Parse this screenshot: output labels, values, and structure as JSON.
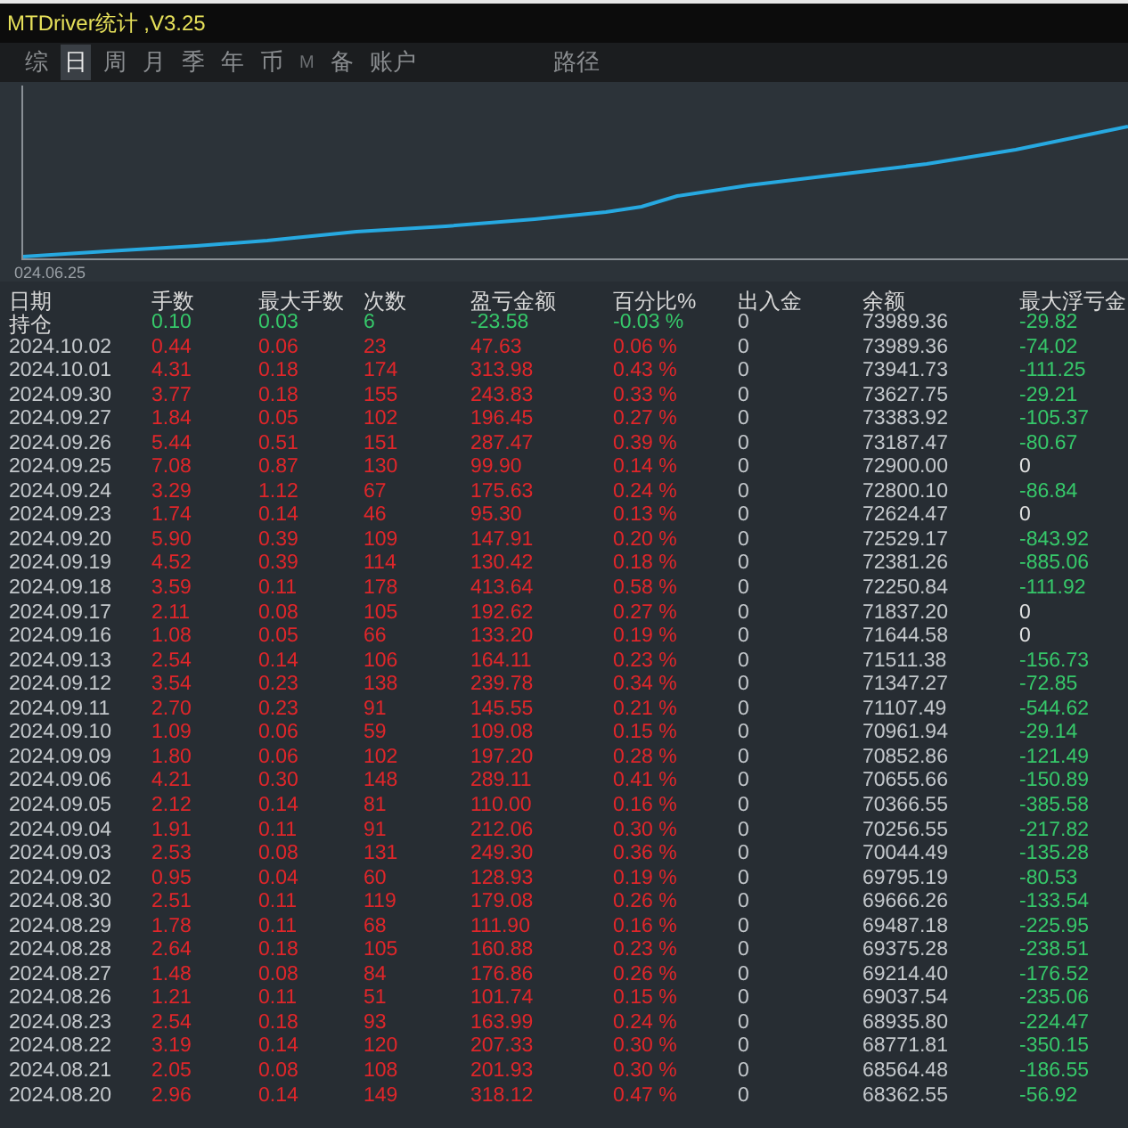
{
  "window": {
    "title": "MTDriver统计 ,V3.25"
  },
  "tabs": [
    {
      "label": "综",
      "selected": false,
      "kind": "tab"
    },
    {
      "label": "日",
      "selected": true,
      "kind": "tab"
    },
    {
      "label": "周",
      "selected": false,
      "kind": "tab"
    },
    {
      "label": "月",
      "selected": false,
      "kind": "tab"
    },
    {
      "label": "季",
      "selected": false,
      "kind": "tab"
    },
    {
      "label": "年",
      "selected": false,
      "kind": "tab"
    },
    {
      "label": "币",
      "selected": false,
      "kind": "tab"
    },
    {
      "label": "M",
      "selected": false,
      "kind": "small"
    },
    {
      "label": "备",
      "selected": false,
      "kind": "tab"
    },
    {
      "label": "账户",
      "selected": false,
      "kind": "tab"
    },
    {
      "label": "路径",
      "selected": false,
      "kind": "apart"
    }
  ],
  "chart": {
    "start_label": "024.06.25"
  },
  "table": {
    "columns": [
      "日期",
      "手数",
      "最大手数",
      "次数",
      "盈亏金额",
      "百分比%",
      "出入金",
      "余额",
      "最大浮亏金"
    ],
    "rows": [
      {
        "date": "持仓",
        "lots": "0.10",
        "max_lots": "0.03",
        "trades": "6",
        "pnl": "-23.58",
        "pct": "-0.03 %",
        "deposit": "0",
        "balance": "73989.36",
        "max_float": "-29.82",
        "position": true,
        "float_highlighted": true
      },
      {
        "date": "2024.10.02",
        "lots": "0.44",
        "max_lots": "0.06",
        "trades": "23",
        "pnl": "47.63",
        "pct": "0.06 %",
        "deposit": "0",
        "balance": "73989.36",
        "max_float": "-74.02",
        "position": false,
        "float_highlighted": true
      },
      {
        "date": "2024.10.01",
        "lots": "4.31",
        "max_lots": "0.18",
        "trades": "174",
        "pnl": "313.98",
        "pct": "0.43 %",
        "deposit": "0",
        "balance": "73941.73",
        "max_float": "-111.25",
        "position": false,
        "float_highlighted": true
      },
      {
        "date": "2024.09.30",
        "lots": "3.77",
        "max_lots": "0.18",
        "trades": "155",
        "pnl": "243.83",
        "pct": "0.33 %",
        "deposit": "0",
        "balance": "73627.75",
        "max_float": "-29.21",
        "position": false,
        "float_highlighted": true
      },
      {
        "date": "2024.09.27",
        "lots": "1.84",
        "max_lots": "0.05",
        "trades": "102",
        "pnl": "196.45",
        "pct": "0.27 %",
        "deposit": "0",
        "balance": "73383.92",
        "max_float": "-105.37",
        "position": false,
        "float_highlighted": true
      },
      {
        "date": "2024.09.26",
        "lots": "5.44",
        "max_lots": "0.51",
        "trades": "151",
        "pnl": "287.47",
        "pct": "0.39 %",
        "deposit": "0",
        "balance": "73187.47",
        "max_float": "-80.67",
        "position": false,
        "float_highlighted": true
      },
      {
        "date": "2024.09.25",
        "lots": "7.08",
        "max_lots": "0.87",
        "trades": "130",
        "pnl": "99.90",
        "pct": "0.14 %",
        "deposit": "0",
        "balance": "72900.00",
        "max_float": "0",
        "position": false,
        "float_highlighted": false
      },
      {
        "date": "2024.09.24",
        "lots": "3.29",
        "max_lots": "1.12",
        "trades": "67",
        "pnl": "175.63",
        "pct": "0.24 %",
        "deposit": "0",
        "balance": "72800.10",
        "max_float": "-86.84",
        "position": false,
        "float_highlighted": true
      },
      {
        "date": "2024.09.23",
        "lots": "1.74",
        "max_lots": "0.14",
        "trades": "46",
        "pnl": "95.30",
        "pct": "0.13 %",
        "deposit": "0",
        "balance": "72624.47",
        "max_float": "0",
        "position": false,
        "float_highlighted": false
      },
      {
        "date": "2024.09.20",
        "lots": "5.90",
        "max_lots": "0.39",
        "trades": "109",
        "pnl": "147.91",
        "pct": "0.20 %",
        "deposit": "0",
        "balance": "72529.17",
        "max_float": "-843.92",
        "position": false,
        "float_highlighted": true
      },
      {
        "date": "2024.09.19",
        "lots": "4.52",
        "max_lots": "0.39",
        "trades": "114",
        "pnl": "130.42",
        "pct": "0.18 %",
        "deposit": "0",
        "balance": "72381.26",
        "max_float": "-885.06",
        "position": false,
        "float_highlighted": true
      },
      {
        "date": "2024.09.18",
        "lots": "3.59",
        "max_lots": "0.11",
        "trades": "178",
        "pnl": "413.64",
        "pct": "0.58 %",
        "deposit": "0",
        "balance": "72250.84",
        "max_float": "-111.92",
        "position": false,
        "float_highlighted": true
      },
      {
        "date": "2024.09.17",
        "lots": "2.11",
        "max_lots": "0.08",
        "trades": "105",
        "pnl": "192.62",
        "pct": "0.27 %",
        "deposit": "0",
        "balance": "71837.20",
        "max_float": "0",
        "position": false,
        "float_highlighted": false
      },
      {
        "date": "2024.09.16",
        "lots": "1.08",
        "max_lots": "0.05",
        "trades": "66",
        "pnl": "133.20",
        "pct": "0.19 %",
        "deposit": "0",
        "balance": "71644.58",
        "max_float": "0",
        "position": false,
        "float_highlighted": false
      },
      {
        "date": "2024.09.13",
        "lots": "2.54",
        "max_lots": "0.14",
        "trades": "106",
        "pnl": "164.11",
        "pct": "0.23 %",
        "deposit": "0",
        "balance": "71511.38",
        "max_float": "-156.73",
        "position": false,
        "float_highlighted": true
      },
      {
        "date": "2024.09.12",
        "lots": "3.54",
        "max_lots": "0.23",
        "trades": "138",
        "pnl": "239.78",
        "pct": "0.34 %",
        "deposit": "0",
        "balance": "71347.27",
        "max_float": "-72.85",
        "position": false,
        "float_highlighted": true
      },
      {
        "date": "2024.09.11",
        "lots": "2.70",
        "max_lots": "0.23",
        "trades": "91",
        "pnl": "145.55",
        "pct": "0.21 %",
        "deposit": "0",
        "balance": "71107.49",
        "max_float": "-544.62",
        "position": false,
        "float_highlighted": true
      },
      {
        "date": "2024.09.10",
        "lots": "1.09",
        "max_lots": "0.06",
        "trades": "59",
        "pnl": "109.08",
        "pct": "0.15 %",
        "deposit": "0",
        "balance": "70961.94",
        "max_float": "-29.14",
        "position": false,
        "float_highlighted": true
      },
      {
        "date": "2024.09.09",
        "lots": "1.80",
        "max_lots": "0.06",
        "trades": "102",
        "pnl": "197.20",
        "pct": "0.28 %",
        "deposit": "0",
        "balance": "70852.86",
        "max_float": "-121.49",
        "position": false,
        "float_highlighted": true
      },
      {
        "date": "2024.09.06",
        "lots": "4.21",
        "max_lots": "0.30",
        "trades": "148",
        "pnl": "289.11",
        "pct": "0.41 %",
        "deposit": "0",
        "balance": "70655.66",
        "max_float": "-150.89",
        "position": false,
        "float_highlighted": true
      },
      {
        "date": "2024.09.05",
        "lots": "2.12",
        "max_lots": "0.14",
        "trades": "81",
        "pnl": "110.00",
        "pct": "0.16 %",
        "deposit": "0",
        "balance": "70366.55",
        "max_float": "-385.58",
        "position": false,
        "float_highlighted": true
      },
      {
        "date": "2024.09.04",
        "lots": "1.91",
        "max_lots": "0.11",
        "trades": "91",
        "pnl": "212.06",
        "pct": "0.30 %",
        "deposit": "0",
        "balance": "70256.55",
        "max_float": "-217.82",
        "position": false,
        "float_highlighted": true
      },
      {
        "date": "2024.09.03",
        "lots": "2.53",
        "max_lots": "0.08",
        "trades": "131",
        "pnl": "249.30",
        "pct": "0.36 %",
        "deposit": "0",
        "balance": "70044.49",
        "max_float": "-135.28",
        "position": false,
        "float_highlighted": true
      },
      {
        "date": "2024.09.02",
        "lots": "0.95",
        "max_lots": "0.04",
        "trades": "60",
        "pnl": "128.93",
        "pct": "0.19 %",
        "deposit": "0",
        "balance": "69795.19",
        "max_float": "-80.53",
        "position": false,
        "float_highlighted": true
      },
      {
        "date": "2024.08.30",
        "lots": "2.51",
        "max_lots": "0.11",
        "trades": "119",
        "pnl": "179.08",
        "pct": "0.26 %",
        "deposit": "0",
        "balance": "69666.26",
        "max_float": "-133.54",
        "position": false,
        "float_highlighted": true
      },
      {
        "date": "2024.08.29",
        "lots": "1.78",
        "max_lots": "0.11",
        "trades": "68",
        "pnl": "111.90",
        "pct": "0.16 %",
        "deposit": "0",
        "balance": "69487.18",
        "max_float": "-225.95",
        "position": false,
        "float_highlighted": true
      },
      {
        "date": "2024.08.28",
        "lots": "2.64",
        "max_lots": "0.18",
        "trades": "105",
        "pnl": "160.88",
        "pct": "0.23 %",
        "deposit": "0",
        "balance": "69375.28",
        "max_float": "-238.51",
        "position": false,
        "float_highlighted": true
      },
      {
        "date": "2024.08.27",
        "lots": "1.48",
        "max_lots": "0.08",
        "trades": "84",
        "pnl": "176.86",
        "pct": "0.26 %",
        "deposit": "0",
        "balance": "69214.40",
        "max_float": "-176.52",
        "position": false,
        "float_highlighted": true
      },
      {
        "date": "2024.08.26",
        "lots": "1.21",
        "max_lots": "0.11",
        "trades": "51",
        "pnl": "101.74",
        "pct": "0.15 %",
        "deposit": "0",
        "balance": "69037.54",
        "max_float": "-235.06",
        "position": false,
        "float_highlighted": true
      },
      {
        "date": "2024.08.23",
        "lots": "2.54",
        "max_lots": "0.18",
        "trades": "93",
        "pnl": "163.99",
        "pct": "0.24 %",
        "deposit": "0",
        "balance": "68935.80",
        "max_float": "-224.47",
        "position": false,
        "float_highlighted": true
      },
      {
        "date": "2024.08.22",
        "lots": "3.19",
        "max_lots": "0.14",
        "trades": "120",
        "pnl": "207.33",
        "pct": "0.30 %",
        "deposit": "0",
        "balance": "68771.81",
        "max_float": "-350.15",
        "position": false,
        "float_highlighted": true
      },
      {
        "date": "2024.08.21",
        "lots": "2.05",
        "max_lots": "0.08",
        "trades": "108",
        "pnl": "201.93",
        "pct": "0.30 %",
        "deposit": "0",
        "balance": "68564.48",
        "max_float": "-186.55",
        "position": false,
        "float_highlighted": true
      },
      {
        "date": "2024.08.20",
        "lots": "2.96",
        "max_lots": "0.14",
        "trades": "149",
        "pnl": "318.12",
        "pct": "0.47 %",
        "deposit": "0",
        "balance": "68362.55",
        "max_float": "-56.92",
        "position": false,
        "float_highlighted": true
      }
    ]
  }
}
